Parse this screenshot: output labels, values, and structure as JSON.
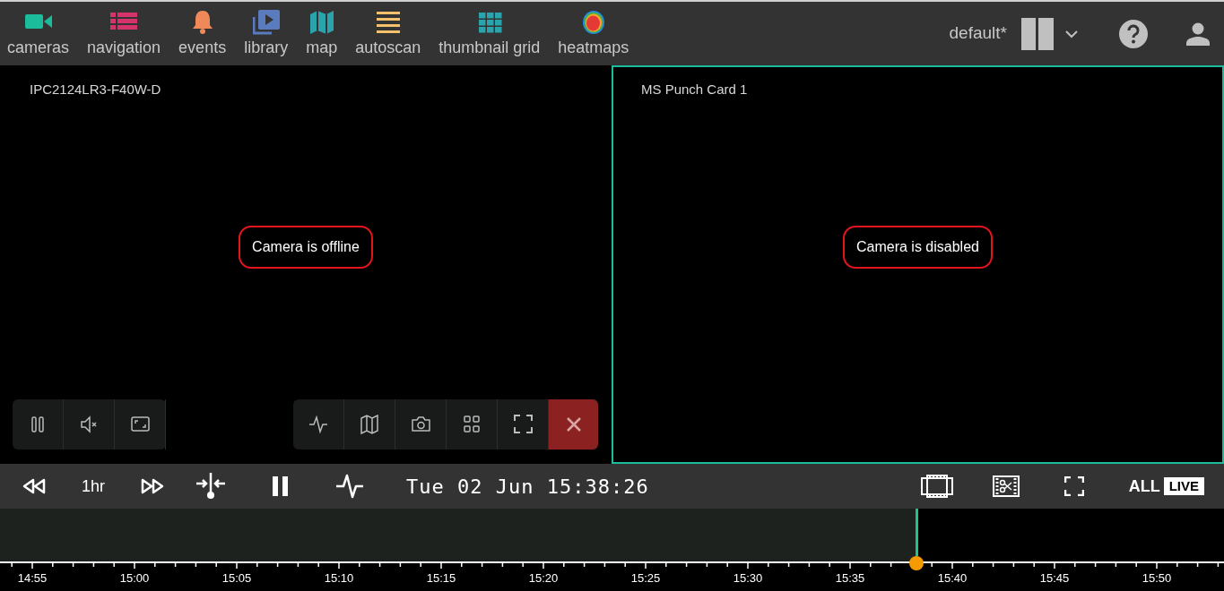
{
  "nav_items": [
    {
      "label": "cameras",
      "kind": "camera",
      "color": "#1abc9c"
    },
    {
      "label": "navigation",
      "kind": "list",
      "color": "#d6336c"
    },
    {
      "label": "events",
      "kind": "bell",
      "color": "#f0895a"
    },
    {
      "label": "library",
      "kind": "library",
      "color": "#5b7bbf"
    },
    {
      "label": "map",
      "kind": "map",
      "color": "#2aa3ad"
    },
    {
      "label": "autoscan",
      "kind": "lines",
      "color": "#f5c26b"
    },
    {
      "label": "thumbnail grid",
      "kind": "grid",
      "color": "#2aa3ad"
    },
    {
      "label": "heatmaps",
      "kind": "heatmap",
      "color": "#e53935"
    }
  ],
  "layout_name": "default*",
  "tiles": [
    {
      "title": "IPC2124LR3-F40W-D",
      "message": "Camera is offline",
      "selected": false,
      "annotated": true,
      "show_controls": true
    },
    {
      "title": "MS Punch Card 1",
      "message": "Camera is disabled",
      "selected": true,
      "annotated": true,
      "show_controls": false
    }
  ],
  "playback": {
    "range": "1hr",
    "datetime": "Tue 02 Jun 15:38:26",
    "all_label": "ALL",
    "live_label": "LIVE"
  },
  "timeline": {
    "level": 0.749,
    "axis_labels": [
      "14:55",
      "15:00",
      "15:05",
      "15:10",
      "15:15",
      "15:20",
      "15:25",
      "15:30",
      "15:35",
      "15:40",
      "15:45",
      "15:50"
    ]
  }
}
